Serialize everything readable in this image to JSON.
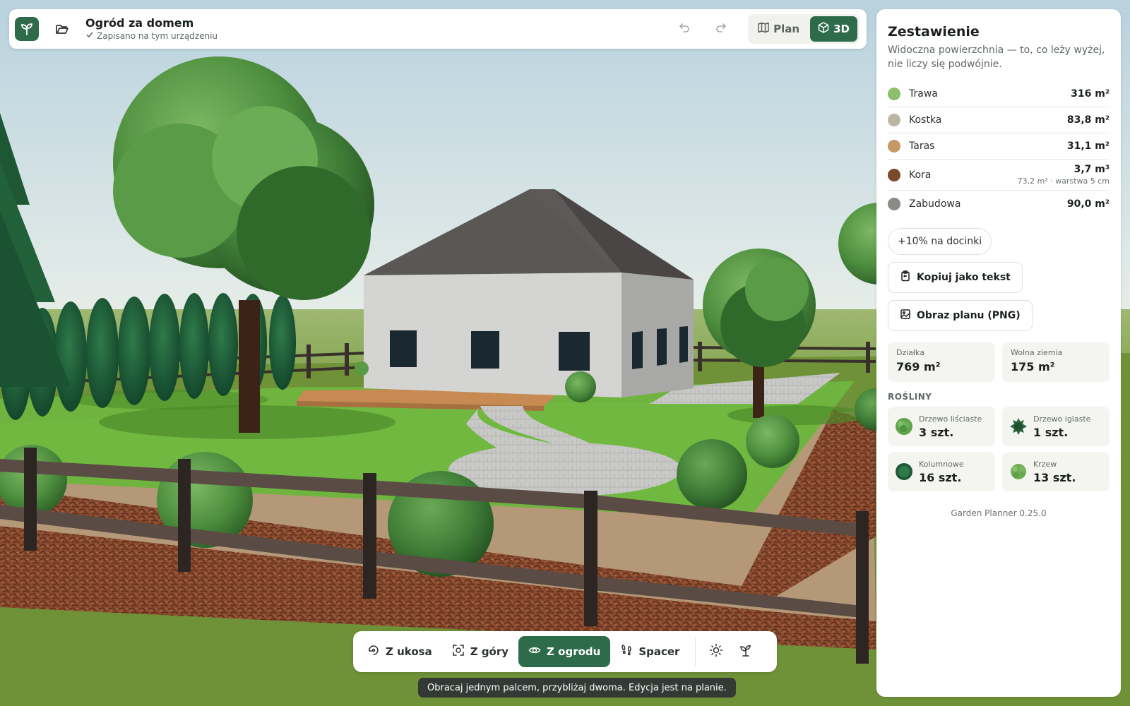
{
  "header": {
    "logo_icon": "sprout-icon",
    "folder_icon": "folder-open-icon",
    "title": "Ogród za domem",
    "save_status": "Zapisano na tym urządzeniu",
    "undo_icon": "undo-icon",
    "redo_icon": "redo-icon",
    "view_toggle": [
      {
        "label": "Plan",
        "icon": "map-icon",
        "active": false
      },
      {
        "label": "3D",
        "icon": "cube-icon",
        "active": true
      }
    ]
  },
  "panel": {
    "title": "Zestawienie",
    "subtitle": "Widoczna powierzchnia — to, co leży wyżej, nie liczy się podwójnie.",
    "materials": [
      {
        "name": "Trawa",
        "value": "316 m²",
        "color": "#8cbf6a"
      },
      {
        "name": "Kostka",
        "value": "83,8 m²",
        "color": "#bdb4a8"
      },
      {
        "name": "Taras",
        "value": "31,1 m²",
        "color": "#c49a62"
      },
      {
        "name": "Kora",
        "value": "3,7 m³",
        "detail": "73,2 m² · warstwa 5 cm",
        "color": "#7a4a2c"
      },
      {
        "name": "Zabudowa",
        "value": "90,0 m²",
        "color": "#8a8a86"
      }
    ],
    "waste_chip": "+10% na docinki",
    "copy_button": "Kopiuj jako tekst",
    "png_button": "Obraz planu (PNG)",
    "stats": [
      {
        "label": "Działka",
        "value": "769 m²"
      },
      {
        "label": "Wolna ziemia",
        "value": "175 m²"
      }
    ],
    "plants_heading": "ROŚLINY",
    "plants": [
      {
        "label": "Drzewo liściaste",
        "value": "3 szt.",
        "icon": "deciduous-tree-icon"
      },
      {
        "label": "Drzewo iglaste",
        "value": "1 szt.",
        "icon": "conifer-tree-icon"
      },
      {
        "label": "Kolumnowe",
        "value": "16 szt.",
        "icon": "columnar-plant-icon"
      },
      {
        "label": "Krzew",
        "value": "13 szt.",
        "icon": "shrub-icon"
      }
    ],
    "version": "Garden Planner 0.25.0"
  },
  "camera": {
    "views": [
      {
        "label": "Z ukosa",
        "icon": "orbit-icon",
        "active": false
      },
      {
        "label": "Z góry",
        "icon": "top-view-icon",
        "active": false
      },
      {
        "label": "Z ogrodu",
        "icon": "eye-icon",
        "active": true
      },
      {
        "label": "Spacer",
        "icon": "footprints-icon",
        "active": false
      }
    ],
    "sun_icon": "sun-icon",
    "plant_icon": "plant-toggle-icon"
  },
  "hint": "Obracaj jednym palcem, przybliżaj dwoma. Edycja jest na planie."
}
